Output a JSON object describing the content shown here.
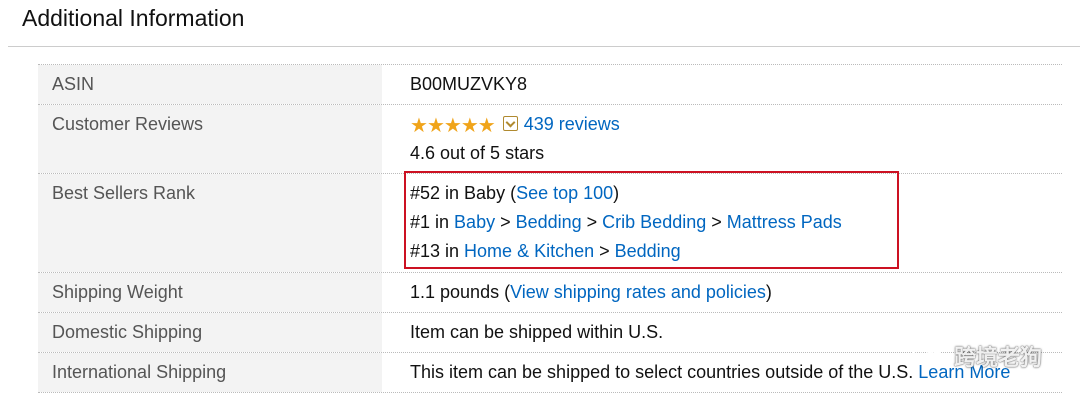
{
  "section": {
    "title": "Additional Information"
  },
  "rows": {
    "asin": {
      "label": "ASIN",
      "value": "B00MUZVKY8"
    },
    "reviews": {
      "label": "Customer Reviews",
      "rating": 4.6,
      "review_link": "439 reviews",
      "rating_text": "4.6 out of 5 stars"
    },
    "rank": {
      "label": "Best Sellers Rank",
      "line1": {
        "prefix": "#52 in Baby (",
        "link": "See top 100",
        "suffix": ")"
      },
      "line2": {
        "prefix": "#1 in ",
        "crumbs": [
          "Baby",
          "Bedding",
          "Crib Bedding",
          "Mattress Pads"
        ],
        "sep": " > "
      },
      "line3": {
        "prefix": "#13 in ",
        "crumbs": [
          "Home & Kitchen",
          "Bedding"
        ],
        "sep": " > "
      }
    },
    "weight": {
      "label": "Shipping Weight",
      "prefix": "1.1 pounds (",
      "link": "View shipping rates and policies",
      "suffix": ")"
    },
    "domestic": {
      "label": "Domestic Shipping",
      "value": "Item can be shipped within U.S."
    },
    "international": {
      "label": "International Shipping",
      "value": "This item can be shipped to select countries outside of the U.S.",
      "link": "Learn More"
    }
  },
  "watermark": {
    "text": "跨境老狗"
  },
  "colors": {
    "link": "#0066c0",
    "label_bg": "#f3f3f3",
    "highlight_border": "#cc1122",
    "star": "#f0a41a"
  }
}
